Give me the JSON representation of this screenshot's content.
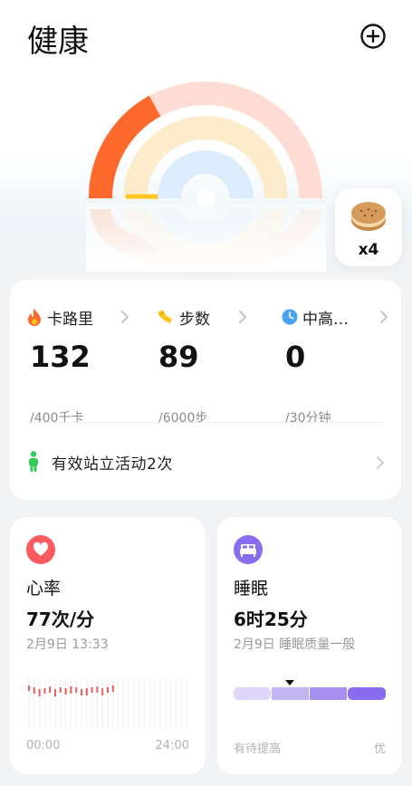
{
  "header": {
    "title": "健康",
    "add_icon": "plus-circle-icon"
  },
  "rings": {
    "calorie": {
      "progress": 0.33,
      "color": "#ff6a2c",
      "track": "#ffddd4"
    },
    "steps": {
      "progress": 0.02,
      "color": "#ffc51f",
      "track": "#fdeccb"
    },
    "exercise": {
      "progress": 0.0,
      "color": "#4aa3f0",
      "track": "#dcecfb"
    }
  },
  "reward": {
    "icon": "cookie-icon",
    "count": "x4"
  },
  "activity": {
    "metrics": [
      {
        "icon": "flame-icon",
        "label": "卡路里",
        "value": "132",
        "goal": "/400千卡",
        "color": "#ff6a2c"
      },
      {
        "icon": "shoe-icon",
        "label": "步数",
        "value": "89",
        "goal": "/6000步",
        "color": "#ffc51f"
      },
      {
        "icon": "clock-icon",
        "label": "中高…",
        "value": "0",
        "goal": "/30分钟",
        "color": "#4aa3f0"
      }
    ],
    "stand": {
      "icon": "standing-person-icon",
      "label": "有效站立活动2次",
      "color": "#34c759"
    }
  },
  "heart_rate": {
    "icon": "heart-icon",
    "title": "心率",
    "value": "77次/分",
    "date": "2月9日 13:33",
    "axis_start": "00:00",
    "axis_end": "24:00",
    "color": "#ff5a5f"
  },
  "sleep": {
    "icon": "bed-icon",
    "title": "睡眠",
    "value": "6时25分",
    "date": "2月9日 睡眠质量一般",
    "scale_low": "有待提高",
    "scale_high": "优",
    "color": "#8a6cf0",
    "marker_segment": 2
  }
}
